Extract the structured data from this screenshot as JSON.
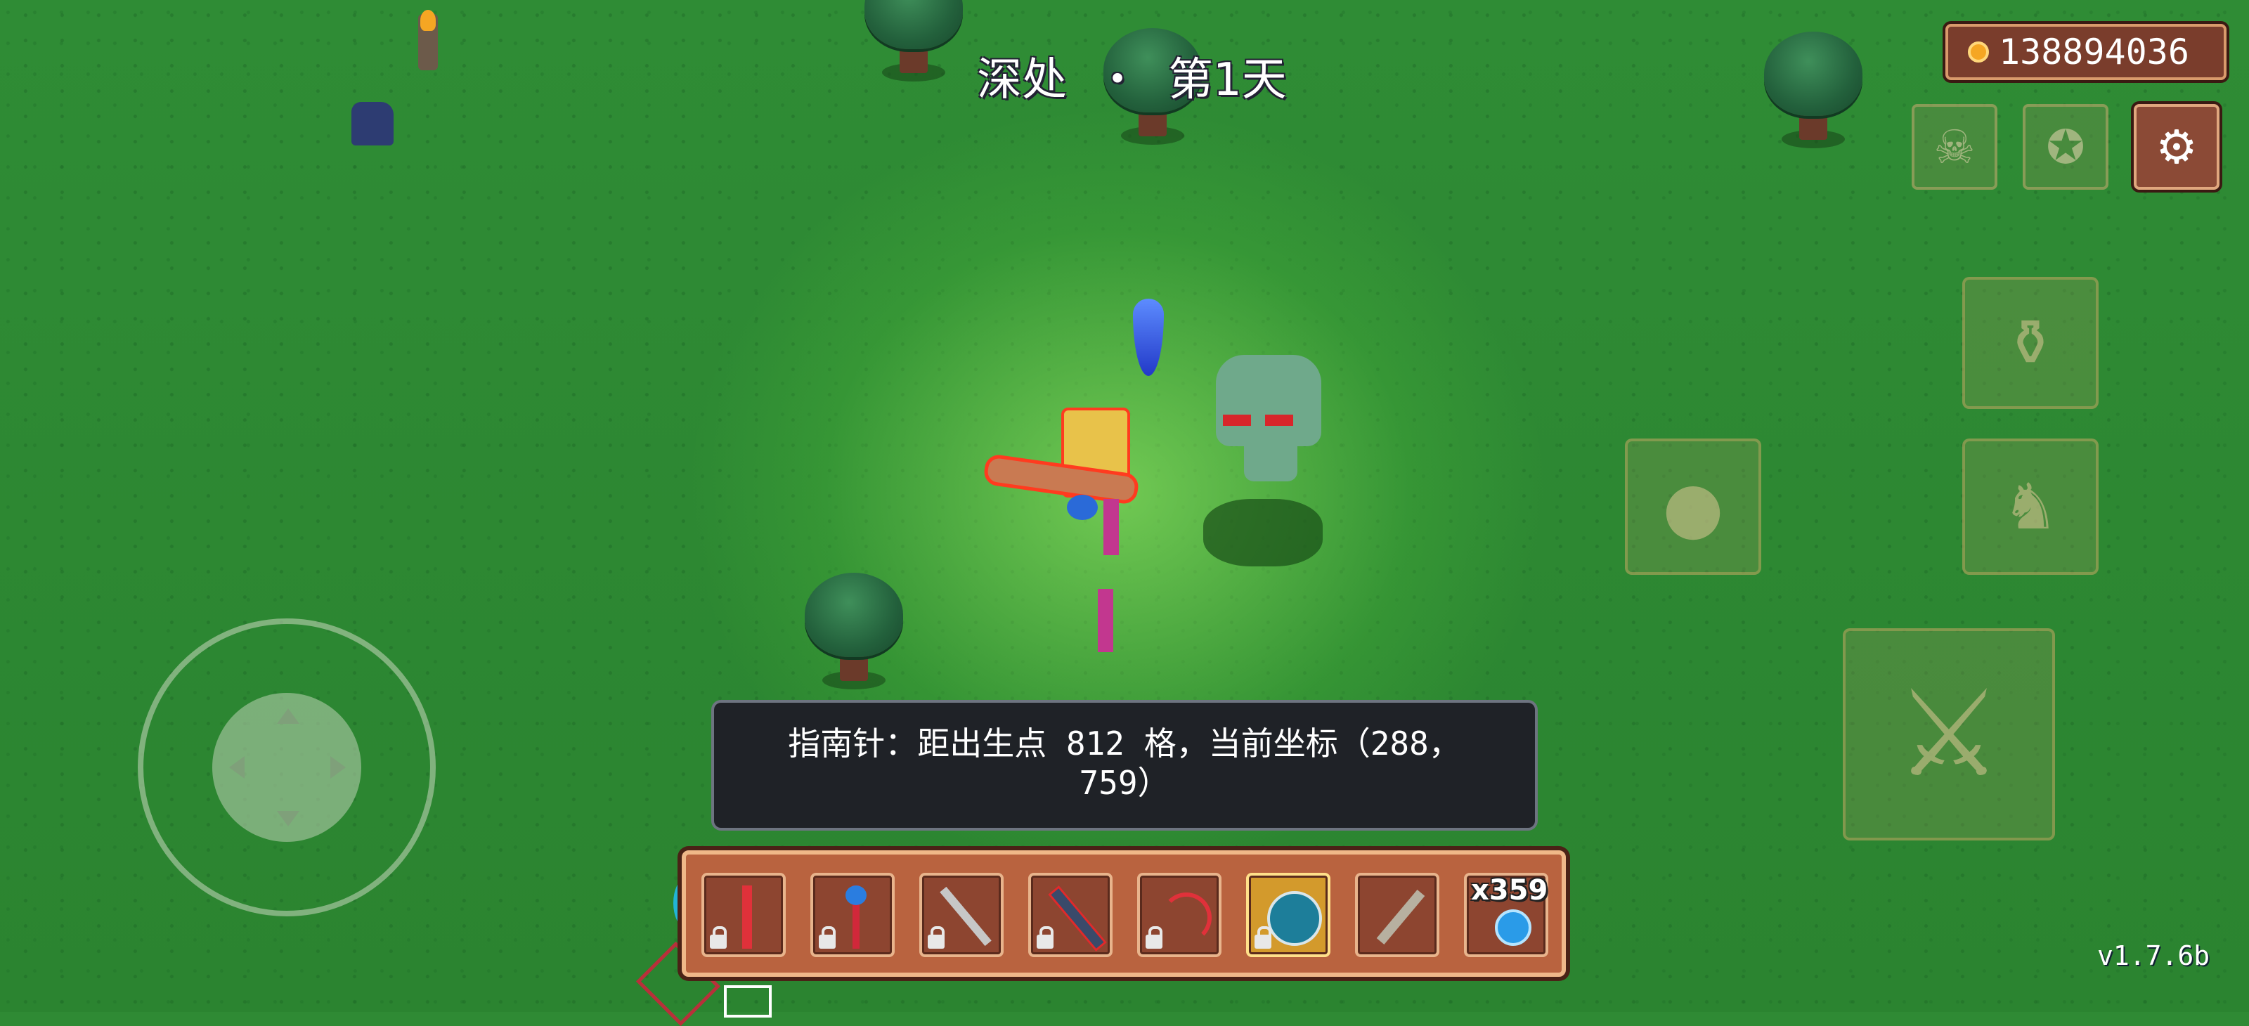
{
  "hud": {
    "title_location": "深处",
    "title_separator": "・",
    "title_day": "第1天",
    "gold_amount": "138894036",
    "version": "v1.7.6b"
  },
  "tooltip": {
    "line1": "指南针：距出生点 812 格，当前坐标（288，",
    "line2": "759）"
  },
  "hotbar": {
    "slots": [
      {
        "icon": "red-sword-icon",
        "locked": true
      },
      {
        "icon": "red-staff-icon",
        "locked": true
      },
      {
        "icon": "chain-whip-icon",
        "locked": true
      },
      {
        "icon": "dark-mace-icon",
        "locked": true
      },
      {
        "icon": "red-bow-icon",
        "locked": true
      },
      {
        "icon": "compass-icon",
        "locked": true,
        "selected": true
      },
      {
        "icon": "syringe-icon",
        "locked": false
      },
      {
        "icon": "blue-orb-icon",
        "locked": false,
        "count": "x359"
      }
    ]
  },
  "buttons": {
    "top_right": [
      "character-icon",
      "bag-icon",
      "settings-icon"
    ],
    "actions": [
      "potion-icon",
      "rock-icon",
      "summon-icon",
      "weapon-attack-icon"
    ]
  },
  "colors": {
    "grass": "#2f8a34",
    "hotbar": "#b9633f",
    "hotbar_border": "#efb889",
    "tooltip_bg": "#1f2227",
    "gold_panel": "#7a3d2c"
  }
}
